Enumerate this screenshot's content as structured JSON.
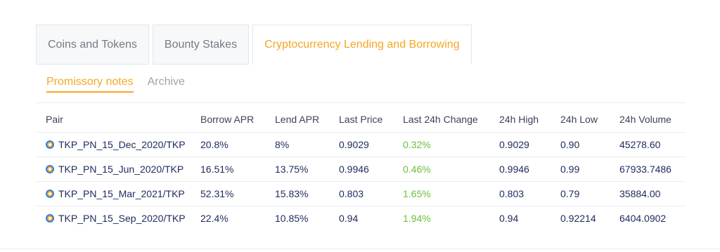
{
  "tabs": [
    {
      "label": "Coins and Tokens",
      "active": false
    },
    {
      "label": "Bounty Stakes",
      "active": false
    },
    {
      "label": "Cryptocurrency Lending and Borrowing",
      "active": true
    }
  ],
  "subtabs": [
    {
      "label": "Promissory notes",
      "active": true
    },
    {
      "label": "Archive",
      "active": false
    }
  ],
  "table": {
    "headers": [
      "Pair",
      "Borrow APR",
      "Lend APR",
      "Last Price",
      "Last 24h Change",
      "24h High",
      "24h Low",
      "24h Volume"
    ],
    "rows": [
      {
        "pair": "TKP_PN_15_Dec_2020/TKP",
        "borrow_apr": "20.8%",
        "lend_apr": "8%",
        "last_price": "0.9029",
        "change": "0.32%",
        "high": "0.9029",
        "low": "0.90",
        "volume": "45278.60"
      },
      {
        "pair": "TKP_PN_15_Jun_2020/TKP",
        "borrow_apr": "16.51%",
        "lend_apr": "13.75%",
        "last_price": "0.9946",
        "change": "0.46%",
        "high": "0.9946",
        "low": "0.99",
        "volume": "67933.7486"
      },
      {
        "pair": "TKP_PN_15_Mar_2021/TKP",
        "borrow_apr": "52.31%",
        "lend_apr": "15.83%",
        "last_price": "0.803",
        "change": "1.65%",
        "high": "0.803",
        "low": "0.79",
        "volume": "35884.00"
      },
      {
        "pair": "TKP_PN_15_Sep_2020/TKP",
        "borrow_apr": "22.4%",
        "lend_apr": "10.85%",
        "last_price": "0.94",
        "change": "1.94%",
        "high": "0.94",
        "low": "0.92214",
        "volume": "6404.0902"
      }
    ]
  },
  "colors": {
    "accent": "#f5a623",
    "positive": "#6cbf3a",
    "text": "#1c2a5c",
    "coin_ring": "#2f7fe8"
  },
  "icons": {
    "pair": "coin-icon"
  }
}
